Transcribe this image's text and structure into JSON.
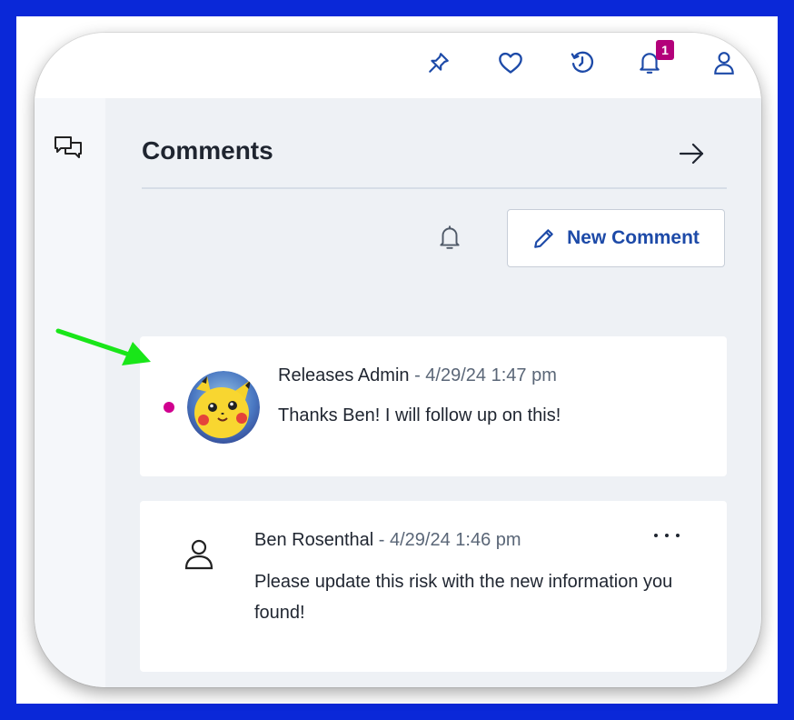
{
  "topbar": {
    "icons": [
      "pin-icon",
      "heart-icon",
      "history-icon",
      "bell-icon",
      "user-icon"
    ],
    "notification_count": "1"
  },
  "sidebar": {
    "comments_icon": "chat-bubbles-icon"
  },
  "panel": {
    "title": "Comments",
    "close_icon": "arrow-right-icon",
    "subscribe_icon": "bell-icon",
    "new_comment_label": "New Comment"
  },
  "comments": [
    {
      "author": "Releases Admin",
      "timestamp": " - 4/29/24 1:47 pm",
      "body": "Thanks Ben! I will follow up on this!",
      "unread": true
    },
    {
      "author": "Ben Rosenthal",
      "timestamp": " - 4/29/24 1:46 pm",
      "body": "Please update this risk with the new information you found!"
    }
  ],
  "colors": {
    "frame": "#0a28d8",
    "accent": "#1d4aa8",
    "badge": "#b3007a",
    "unread_dot": "#d0008f",
    "annotation_arrow": "#19e619"
  }
}
